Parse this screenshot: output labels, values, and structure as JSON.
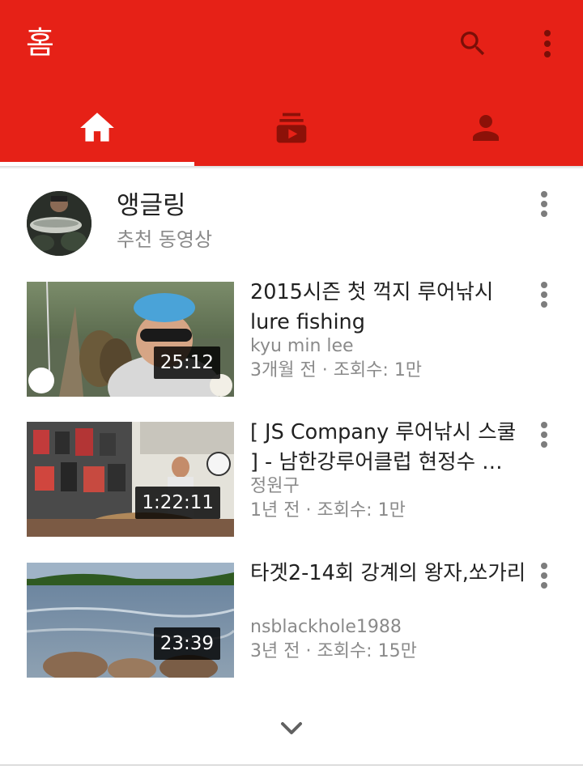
{
  "colors": {
    "brand_red": "#e62117",
    "inactive_tab_icon": "#8c1108"
  },
  "appbar": {
    "title": "홈",
    "search_icon": "search-icon",
    "more_icon": "more-vert-icon"
  },
  "tabs": [
    {
      "name": "home",
      "icon": "home-icon",
      "active": true
    },
    {
      "name": "subscriptions",
      "icon": "subscriptions-icon",
      "active": false
    },
    {
      "name": "account",
      "icon": "account-icon",
      "active": false
    }
  ],
  "section": {
    "title": "앵글링",
    "subtitle": "추천 동영상"
  },
  "videos": [
    {
      "title": "2015시즌 첫 꺽지 루어낚시 lure fishing",
      "channel": "kyu min lee",
      "meta": "3개월 전 · 조회수: 1만",
      "duration": "25:12"
    },
    {
      "title": "[ JS Company 루어낚시 스쿨 ] - 남한강루어클럽 현정수 …",
      "channel": "정원구",
      "meta": "1년 전 · 조회수: 1만",
      "duration": "1:22:11"
    },
    {
      "title": "타겟2-14회 강계의 왕자,쏘가리",
      "channel": "nsblackhole1988",
      "meta": "3년 전 · 조회수: 15만",
      "duration": "23:39"
    }
  ]
}
